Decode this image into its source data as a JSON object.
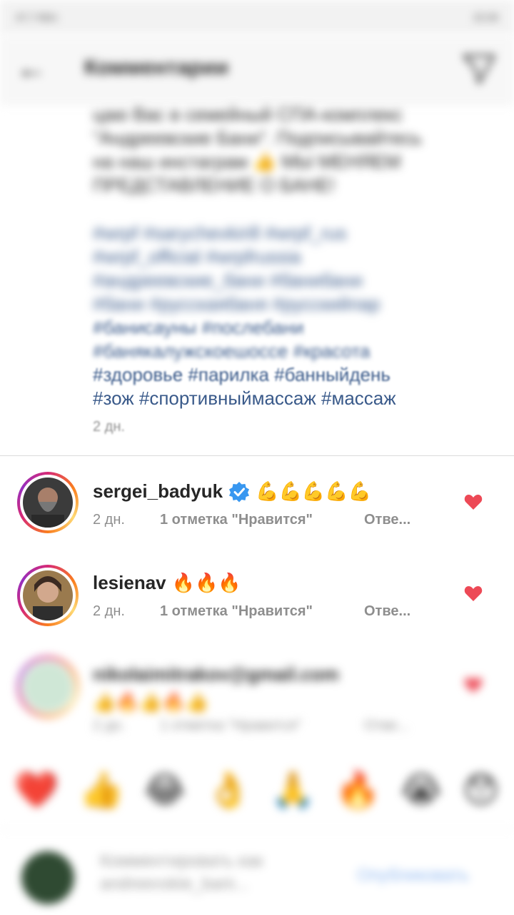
{
  "status_bar": {
    "left_text": "47,7 КБ/с",
    "right_text": "22:26"
  },
  "header": {
    "title": "Комментарии"
  },
  "caption": {
    "text_lines": [
      "цаю Вас в семейный СПА-комплекс",
      "\"Андреевские Бани\". Подписывайтесь",
      "на наш инстаграм 👍 МЫ МЕНЯЕМ",
      "ПРЕДСТАВЛЕНИЕ О БАНЕ!"
    ],
    "tag_lines": [
      "#wrpf #sarychevkirill #wrpf_rus",
      "#wrpf_official #wrpfrussia",
      "#андреевские_бани #банибани",
      "#бани #русскаябаня #русскийпар",
      "#банисауны #послебани",
      "#банякалужскоешоссе #красота",
      "#здоровье #парилка #банныйдень",
      "#зож #спортивныймассаж #массаж"
    ],
    "time": "2 дн."
  },
  "comments": [
    {
      "username": "sergei_badyuk",
      "verified": true,
      "text": "💪💪💪💪💪",
      "time": "2 дн.",
      "likes": "1 отметка \"Нравится\"",
      "reply": "Отве..."
    },
    {
      "username": "lesienav",
      "verified": false,
      "text": "🔥🔥🔥",
      "time": "2 дн.",
      "likes": "1 отметка \"Нравится\"",
      "reply": "Отве..."
    },
    {
      "username": "nikolaimitrakov@gmail.com",
      "verified": false,
      "text": "👍🔥👍🔥👍",
      "time": "2 дн.",
      "likes": "1 отметка \"Нравится\"",
      "reply": "Отве..."
    }
  ],
  "emoji_bar": [
    "❤️",
    "👍",
    "😂",
    "👌",
    "🙏",
    "🔥",
    "😭",
    "😯"
  ],
  "input": {
    "placeholder": "Комментировать как andreevskie_bani...",
    "publish_label": "Опубликовать"
  },
  "colors": {
    "accent_heart": "#ed4956",
    "verified_blue": "#3897f0",
    "hashtag": "#3a5a8a"
  }
}
